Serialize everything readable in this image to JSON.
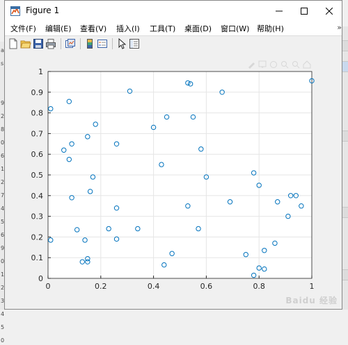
{
  "window": {
    "title": "Figure 1"
  },
  "menu": [
    {
      "id": "file",
      "label": "文件(F)"
    },
    {
      "id": "edit",
      "label": "编辑(E)"
    },
    {
      "id": "view",
      "label": "查看(V)"
    },
    {
      "id": "insert",
      "label": "插入(I)"
    },
    {
      "id": "tools",
      "label": "工具(T)"
    },
    {
      "id": "desktop",
      "label": "桌面(D)"
    },
    {
      "id": "window",
      "label": "窗口(W)"
    },
    {
      "id": "help",
      "label": "帮助(H)"
    }
  ],
  "menu_overflow": "»",
  "toolbar": [
    "new-figure-icon",
    "open-file-icon",
    "save-icon",
    "print-icon",
    "link-plot-icon",
    "insert-colorbar-icon",
    "insert-legend-icon",
    "edit-plot-icon",
    "property-inspector-icon"
  ],
  "colors": {
    "marker": "#0072BD",
    "grid": "#e5e5e5",
    "axes": "#262626",
    "canvas": "#f0f0f0"
  },
  "chart_data": {
    "type": "scatter",
    "marker": "o",
    "xlim": [
      0,
      1
    ],
    "ylim": [
      0,
      1
    ],
    "xticks": [
      "0",
      "0.2",
      "0.4",
      "0.6",
      "0.8",
      "1"
    ],
    "yticks": [
      "0",
      "0.1",
      "0.2",
      "0.3",
      "0.4",
      "0.5",
      "0.6",
      "0.7",
      "0.8",
      "0.9",
      "1"
    ],
    "grid": true,
    "points": [
      [
        0.01,
        0.82
      ],
      [
        0.08,
        0.855
      ],
      [
        0.31,
        0.905
      ],
      [
        0.53,
        0.945
      ],
      [
        0.54,
        0.94
      ],
      [
        0.66,
        0.9
      ],
      [
        1.0,
        0.955
      ],
      [
        0.18,
        0.745
      ],
      [
        0.45,
        0.78
      ],
      [
        0.55,
        0.78
      ],
      [
        0.4,
        0.73
      ],
      [
        0.15,
        0.685
      ],
      [
        0.09,
        0.65
      ],
      [
        0.26,
        0.65
      ],
      [
        0.06,
        0.62
      ],
      [
        0.58,
        0.625
      ],
      [
        0.08,
        0.575
      ],
      [
        0.43,
        0.55
      ],
      [
        0.78,
        0.51
      ],
      [
        0.17,
        0.49
      ],
      [
        0.6,
        0.49
      ],
      [
        0.8,
        0.45
      ],
      [
        0.16,
        0.42
      ],
      [
        0.92,
        0.4
      ],
      [
        0.94,
        0.4
      ],
      [
        0.09,
        0.39
      ],
      [
        0.69,
        0.37
      ],
      [
        0.87,
        0.37
      ],
      [
        0.96,
        0.35
      ],
      [
        0.53,
        0.35
      ],
      [
        0.26,
        0.34
      ],
      [
        0.91,
        0.3
      ],
      [
        0.23,
        0.24
      ],
      [
        0.34,
        0.24
      ],
      [
        0.57,
        0.24
      ],
      [
        0.11,
        0.235
      ],
      [
        0.01,
        0.185
      ],
      [
        0.14,
        0.185
      ],
      [
        0.26,
        0.19
      ],
      [
        0.86,
        0.17
      ],
      [
        0.82,
        0.135
      ],
      [
        0.47,
        0.12
      ],
      [
        0.75,
        0.115
      ],
      [
        0.15,
        0.095
      ],
      [
        0.13,
        0.08
      ],
      [
        0.15,
        0.08
      ],
      [
        0.44,
        0.065
      ],
      [
        0.8,
        0.05
      ],
      [
        0.82,
        0.045
      ],
      [
        0.78,
        0.015
      ]
    ]
  },
  "background": {
    "left_fragment_chars": [
      "a",
      "s",
      "",
      "",
      "9",
      "2",
      "8",
      "0",
      "6",
      "1",
      "2",
      "7",
      "4",
      "5",
      "6",
      "9",
      "0",
      "1",
      "2",
      "3",
      "4",
      "5",
      "0"
    ]
  },
  "watermark": "Baidu 经验"
}
